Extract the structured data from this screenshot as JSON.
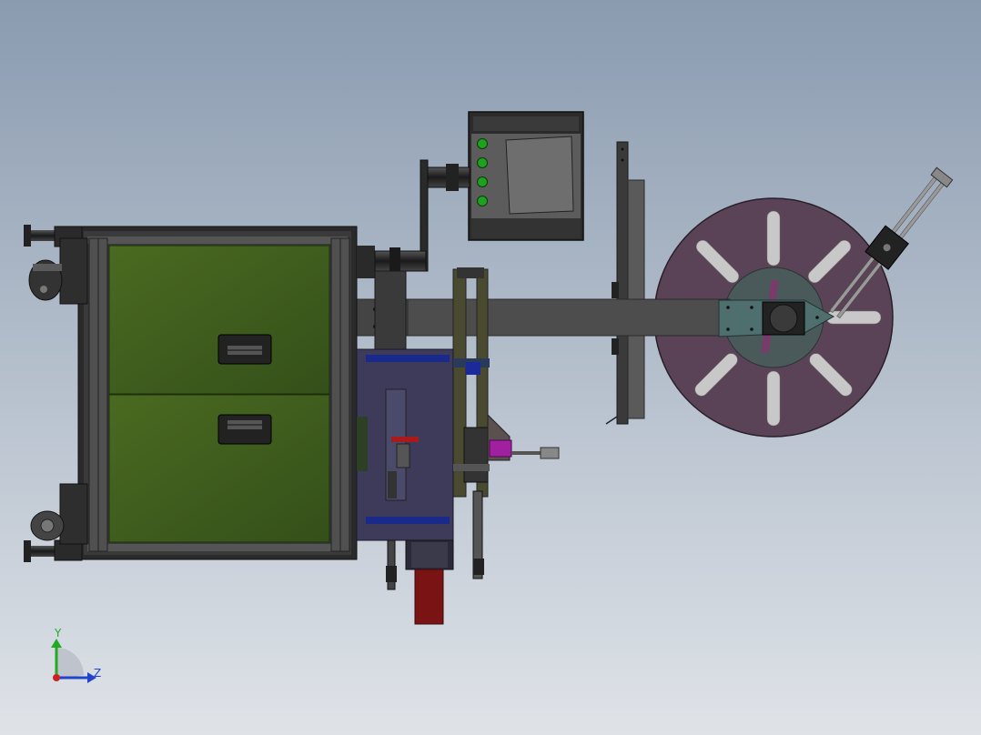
{
  "colors": {
    "background_top": "#8a9bb0",
    "background_bottom": "#dfe3e8",
    "cabinet_panel": "#3e5a1c",
    "frame_dark": "#2a2a2a",
    "frame_mid": "#4a4a4a",
    "arm": "#4d4d4d",
    "spool": "#5a4356",
    "spool_hub": "#4a5a5a",
    "mechanism": "#3d3a5a",
    "accent_blue": "#1a2a8a",
    "accent_red": "#7a1414",
    "accent_magenta": "#a020a0",
    "button_green": "#1fa01f",
    "axis_x": "#cc2222",
    "axis_y": "#22aa22",
    "axis_z": "#2244cc"
  },
  "triad": {
    "y_label": "Y",
    "z_label": "Z"
  }
}
